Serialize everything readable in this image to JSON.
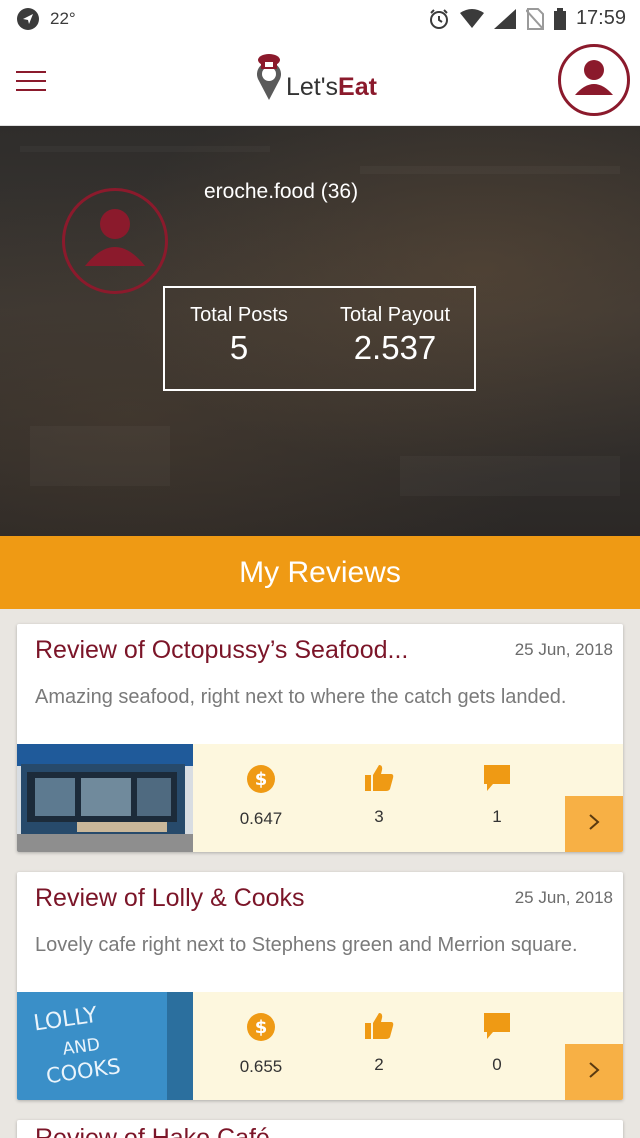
{
  "status_bar": {
    "temperature": "22°",
    "time": "17:59"
  },
  "app": {
    "logo_prefix": "Let's",
    "logo_bold": "Eat",
    "accent": "#8b1a2c",
    "orange": "#ef9a14"
  },
  "profile": {
    "username": "eroche.food (36)",
    "total_posts_label": "Total Posts",
    "total_posts": "5",
    "total_payout_label": "Total Payout",
    "total_payout": "2.537"
  },
  "section": {
    "title": "My Reviews"
  },
  "reviews": [
    {
      "title": "Review of Octopussy’s Seafood...",
      "date": "25 Jun, 2018",
      "description": "Amazing seafood, right next to where the catch gets landed.",
      "payout": "0.647",
      "likes": "3",
      "comments": "1"
    },
    {
      "title": "Review of Lolly & Cooks",
      "date": "25 Jun, 2018",
      "description": "Lovely cafe right next to Stephens green and Merrion square.",
      "payout": "0.655",
      "likes": "2",
      "comments": "0",
      "thumb_text": "LOLLY AND COOKS"
    }
  ],
  "peek": {
    "title": "Review of Hako Café"
  }
}
